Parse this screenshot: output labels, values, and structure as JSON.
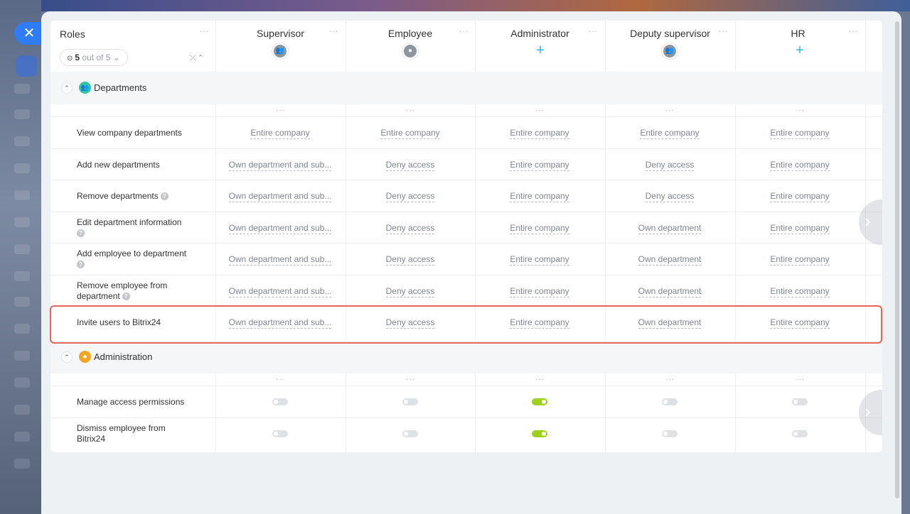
{
  "close_label": "✕",
  "header": {
    "roles_title": "Roles",
    "counter": {
      "icon": "eye-icon",
      "shown": "5",
      "suffix": "out of 5"
    },
    "collapse_label": "⤫⌃"
  },
  "roles": [
    {
      "name": "Supervisor",
      "icon": "group-icon"
    },
    {
      "name": "Employee",
      "icon": "user-icon"
    },
    {
      "name": "Administrator",
      "icon": "plus-icon"
    },
    {
      "name": "Deputy supervisor",
      "icon": "group-icon"
    },
    {
      "name": "HR",
      "icon": "plus-icon"
    }
  ],
  "sections": [
    {
      "title": "Departments",
      "color": "#2fc6a5",
      "rows": [
        {
          "label": "View company departments",
          "help": false,
          "values": [
            "Entire company",
            "Entire company",
            "Entire company",
            "Entire company",
            "Entire company"
          ]
        },
        {
          "label": "Add new departments",
          "help": false,
          "values": [
            "Own department and sub...",
            "Deny access",
            "Entire company",
            "Deny access",
            "Entire company"
          ]
        },
        {
          "label": "Remove departments",
          "help": true,
          "values": [
            "Own department and sub...",
            "Deny access",
            "Entire company",
            "Deny access",
            "Entire company"
          ]
        },
        {
          "label": "Edit department information",
          "help": true,
          "values": [
            "Own department and sub...",
            "Deny access",
            "Entire company",
            "Own department",
            "Entire company"
          ]
        },
        {
          "label": "Add employee to department",
          "help": true,
          "values": [
            "Own department and sub...",
            "Deny access",
            "Entire company",
            "Own department",
            "Entire company"
          ]
        },
        {
          "label": "Remove employee from department",
          "help": true,
          "values": [
            "Own department and sub...",
            "Deny access",
            "Entire company",
            "Own department",
            "Entire company"
          ]
        },
        {
          "label": "Invite users to Bitrix24",
          "help": false,
          "values": [
            "Own department and sub...",
            "Deny access",
            "Entire company",
            "Own department",
            "Entire company"
          ]
        }
      ]
    },
    {
      "title": "Administration",
      "color": "#f4a623",
      "rows": [
        {
          "label": "Manage access permissions",
          "toggles": [
            false,
            false,
            true,
            false,
            false
          ]
        },
        {
          "label": "Dismiss employee from Bitrix24",
          "toggles": [
            false,
            false,
            true,
            false,
            false
          ]
        }
      ]
    }
  ],
  "colors": {
    "accent": "#2f7cf6",
    "highlight": "#e86459",
    "toggle_on": "#9ed11c"
  }
}
